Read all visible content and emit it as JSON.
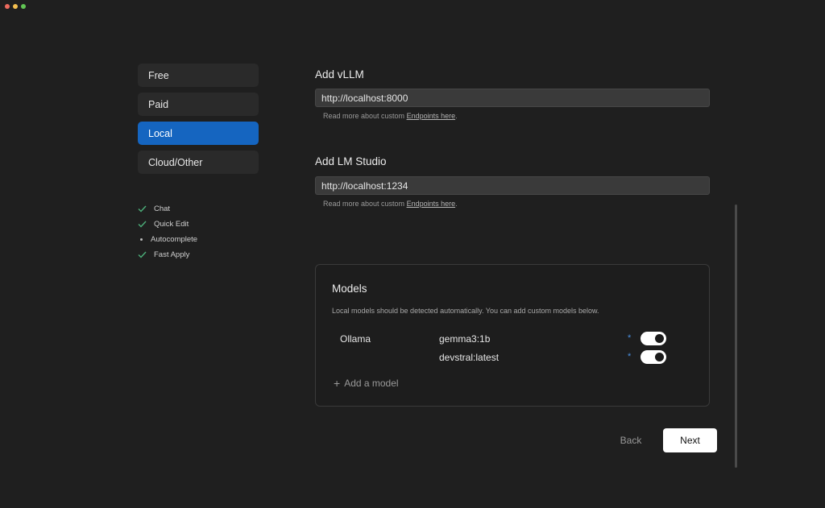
{
  "tabs": [
    {
      "label": "Free",
      "active": false
    },
    {
      "label": "Paid",
      "active": false
    },
    {
      "label": "Local",
      "active": true
    },
    {
      "label": "Cloud/Other",
      "active": false
    }
  ],
  "features": [
    {
      "label": "Chat",
      "status": "check"
    },
    {
      "label": "Quick Edit",
      "status": "check"
    },
    {
      "label": "Autocomplete",
      "status": "dot"
    },
    {
      "label": "Fast Apply",
      "status": "check"
    }
  ],
  "vllm": {
    "title": "Add vLLM",
    "url": "http://localhost:8000",
    "help_prefix": "Read more about custom ",
    "help_link": "Endpoints here",
    "help_suffix": "."
  },
  "lmstudio": {
    "title": "Add LM Studio",
    "url": "http://localhost:1234",
    "help_prefix": "Read more about custom ",
    "help_link": "Endpoints here",
    "help_suffix": "."
  },
  "models": {
    "title": "Models",
    "description": "Local models should be detected automatically. You can add custom models below.",
    "provider": "Ollama",
    "items": [
      {
        "name": "gemma3:1b",
        "star": "*",
        "enabled": true
      },
      {
        "name": "devstral:latest",
        "star": "*",
        "enabled": true
      }
    ],
    "add_label": "Add a model",
    "add_icon": "+"
  },
  "footer": {
    "back_label": "Back",
    "next_label": "Next"
  },
  "colors": {
    "accent": "#1565c0",
    "check": "#4caf7a",
    "star": "#4a90e2"
  }
}
